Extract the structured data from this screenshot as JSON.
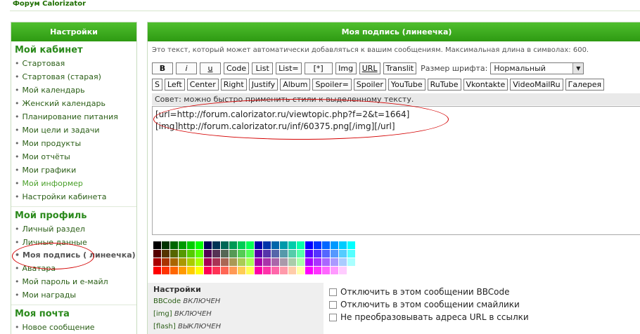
{
  "header": {
    "forum_link": "Форум Calorizator"
  },
  "sidebar": {
    "title": "Настройки",
    "sections": [
      {
        "title": "Мой кабинет",
        "items": [
          "Стартовая",
          "Стартовая (старая)",
          "Мой календарь",
          "Женский календарь",
          "Планирование питания",
          "Мои цели и задачи",
          "Мои продукты",
          "Мои отчёты",
          "Мои графики",
          "Мой информер",
          "Настройки кабинета"
        ]
      },
      {
        "title": "Мой профиль",
        "items": [
          "Личный раздел",
          "Личные данные",
          "Моя подпись ( линеечка)",
          "Аватара",
          "Мой пароль и е-майл",
          "Мои награды"
        ]
      },
      {
        "title": "Моя почта",
        "items": [
          "Новое сообщение"
        ]
      }
    ]
  },
  "main": {
    "title": "Моя подпись (линеечка)",
    "description": "Это текст, который может автоматически добавляться к вашим сообщениям. Максимальная длина в символах: 600.",
    "toolbar_row1": [
      "B",
      "i",
      "u",
      "Code",
      "List",
      "List=",
      "[*]",
      "Img",
      "URL",
      "Translit"
    ],
    "font_size_label": "Размер шрифта:",
    "font_size_value": "Нормальный",
    "toolbar_row2": [
      "S",
      "Left",
      "Center",
      "Right",
      "Justify",
      "Album",
      "Spoiler=",
      "Spoiler",
      "YouTube",
      "RuTube",
      "Vkontakte",
      "VideoMailRu",
      "Галерея"
    ],
    "tip": "Совет: можно быстро применить стили к выделенному тексту.",
    "signature_lines": [
      "[url=http://forum.calorizator.ru/viewtopic.php?f=2&t=1664]",
      "[img]http://forum.calorizator.ru/inf/60375.png[/img][/url]"
    ],
    "settings": {
      "title": "Настройки",
      "lines": [
        {
          "name": "BBCode",
          "state": "ВКЛЮЧЕН"
        },
        {
          "name": "[img]",
          "state": "ВКЛЮЧЕН"
        },
        {
          "name": "[flash]",
          "state": "ВЫКЛЮЧЕН"
        }
      ],
      "checkboxes": [
        "Отключить в этом сообщении BBCode",
        "Отключить в этом сообщении смайлики",
        "Не преобразовывать адреса URL в ссылки"
      ]
    }
  },
  "colors": {
    "header_green": "#3aa81c",
    "link_green": "#2a5e16",
    "annotation_red": "#d40000"
  }
}
